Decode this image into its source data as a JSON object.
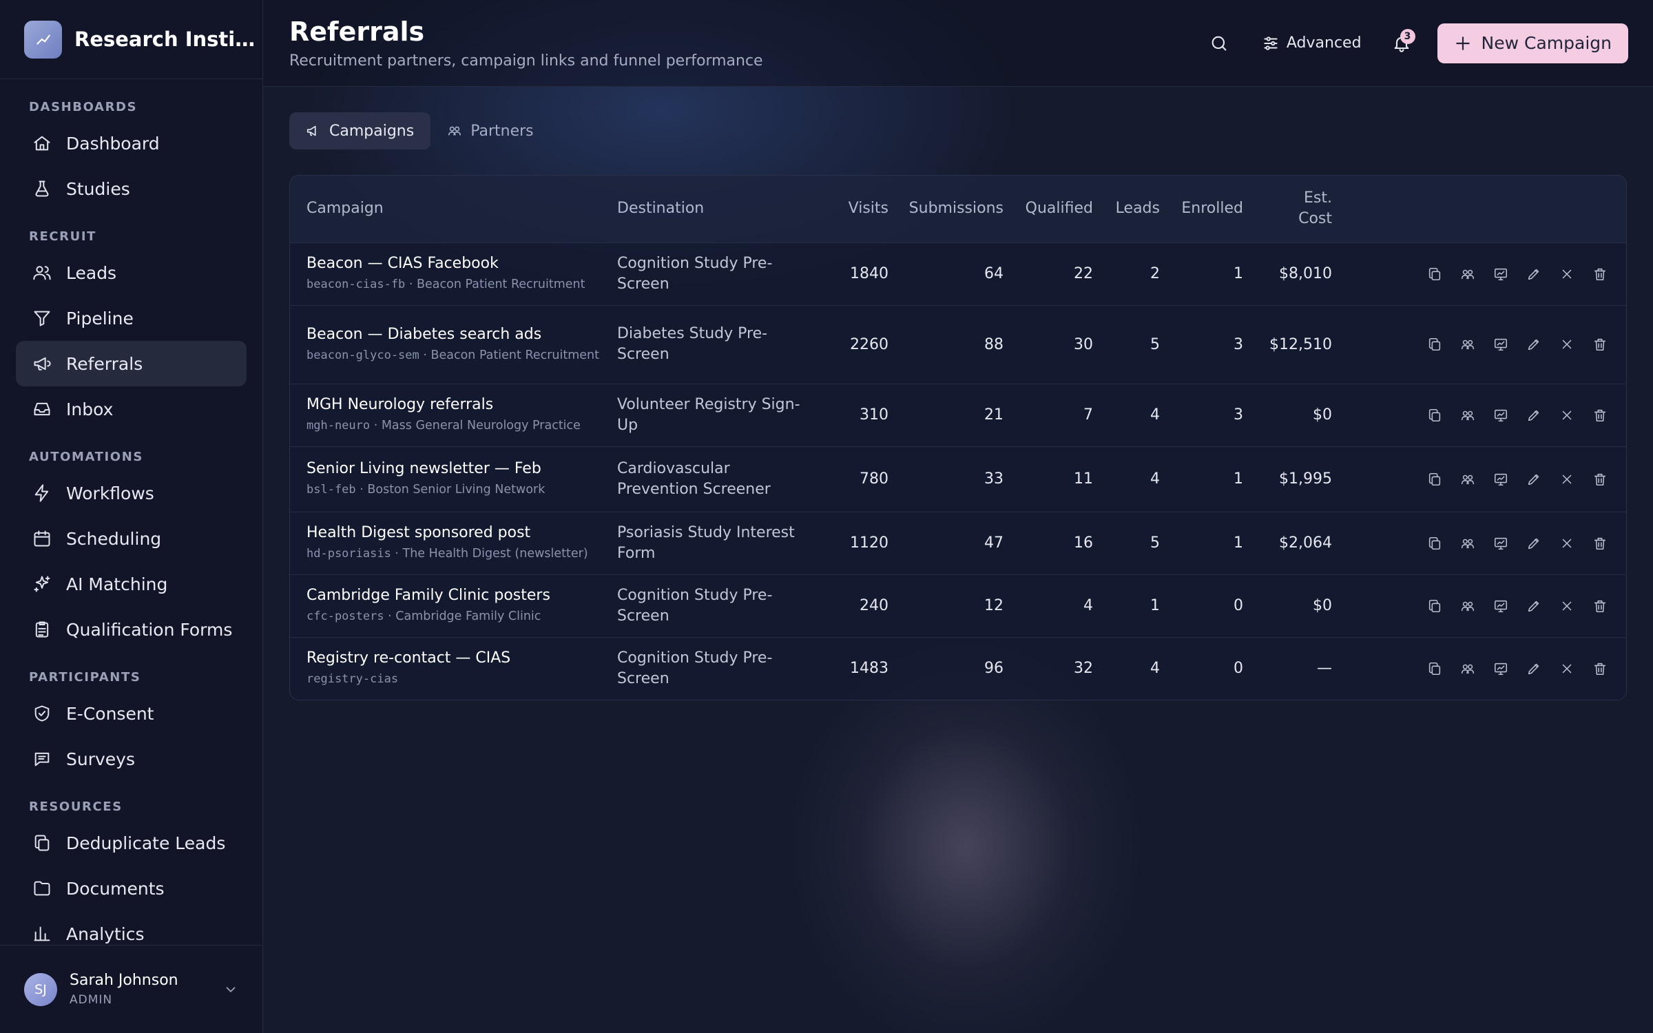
{
  "brand": {
    "name": "Research Institute"
  },
  "sidebar": {
    "sections": [
      {
        "title": "DASHBOARDS",
        "items": [
          {
            "label": "Dashboard",
            "icon": "home-icon"
          },
          {
            "label": "Studies",
            "icon": "flask-icon"
          }
        ]
      },
      {
        "title": "RECRUIT",
        "items": [
          {
            "label": "Leads",
            "icon": "users-icon"
          },
          {
            "label": "Pipeline",
            "icon": "funnel-icon"
          },
          {
            "label": "Referrals",
            "icon": "megaphone-icon",
            "active": true
          },
          {
            "label": "Inbox",
            "icon": "inbox-icon"
          }
        ]
      },
      {
        "title": "AUTOMATIONS",
        "items": [
          {
            "label": "Workflows",
            "icon": "bolt-icon"
          },
          {
            "label": "Scheduling",
            "icon": "calendar-icon"
          },
          {
            "label": "AI Matching",
            "icon": "sparkles-icon"
          },
          {
            "label": "Qualification Forms",
            "icon": "clipboard-icon"
          }
        ]
      },
      {
        "title": "PARTICIPANTS",
        "items": [
          {
            "label": "E-Consent",
            "icon": "shield-check-icon"
          },
          {
            "label": "Surveys",
            "icon": "chat-icon"
          }
        ]
      },
      {
        "title": "RESOURCES",
        "items": [
          {
            "label": "Deduplicate Leads",
            "icon": "copy-icon"
          },
          {
            "label": "Documents",
            "icon": "folder-icon"
          },
          {
            "label": "Analytics",
            "icon": "chart-icon"
          }
        ]
      }
    ]
  },
  "user": {
    "initials": "SJ",
    "name": "Sarah Johnson",
    "role": "ADMIN"
  },
  "header": {
    "title": "Referrals",
    "subtitle": "Recruitment partners, campaign links and funnel performance",
    "advanced_label": "Advanced",
    "notification_count": "3",
    "new_button_label": "New Campaign"
  },
  "tabs": [
    {
      "label": "Campaigns",
      "active": true
    },
    {
      "label": "Partners",
      "active": false
    }
  ],
  "table": {
    "columns": {
      "campaign": "Campaign",
      "destination": "Destination",
      "visits": "Visits",
      "submissions": "Submissions",
      "qualified": "Qualified",
      "leads": "Leads",
      "enrolled": "Enrolled",
      "est": "Est.",
      "cost": "Cost"
    },
    "rows": [
      {
        "name": "Beacon — CIAS Facebook",
        "slug": "beacon-cias-fb",
        "partner": "Beacon Patient Recruitment",
        "destination": "Cognition Study Pre-Screen",
        "visits": "1840",
        "submissions": "64",
        "qualified": "22",
        "leads": "2",
        "enrolled": "1",
        "cost": "$8,010"
      },
      {
        "name": "Beacon — Diabetes search ads",
        "slug": "beacon-glyco-sem",
        "partner": "Beacon Patient Recruitment",
        "destination": "Diabetes Study Pre-Screen",
        "visits": "2260",
        "submissions": "88",
        "qualified": "30",
        "leads": "5",
        "enrolled": "3",
        "cost": "$12,510"
      },
      {
        "name": "MGH Neurology referrals",
        "slug": "mgh-neuro",
        "partner": "Mass General Neurology Practice",
        "destination": "Volunteer Registry Sign-Up",
        "visits": "310",
        "submissions": "21",
        "qualified": "7",
        "leads": "4",
        "enrolled": "3",
        "cost": "$0"
      },
      {
        "name": "Senior Living newsletter — Feb",
        "slug": "bsl-feb",
        "partner": "Boston Senior Living Network",
        "destination": "Cardiovascular Prevention Screener",
        "visits": "780",
        "submissions": "33",
        "qualified": "11",
        "leads": "4",
        "enrolled": "1",
        "cost": "$1,995"
      },
      {
        "name": "Health Digest sponsored post",
        "slug": "hd-psoriasis",
        "partner": "The Health Digest (newsletter)",
        "destination": "Psoriasis Study Interest Form",
        "visits": "1120",
        "submissions": "47",
        "qualified": "16",
        "leads": "5",
        "enrolled": "1",
        "cost": "$2,064"
      },
      {
        "name": "Cambridge Family Clinic posters",
        "slug": "cfc-posters",
        "partner": "Cambridge Family Clinic",
        "destination": "Cognition Study Pre-Screen",
        "visits": "240",
        "submissions": "12",
        "qualified": "4",
        "leads": "1",
        "enrolled": "0",
        "cost": "$0"
      },
      {
        "name": "Registry re-contact — CIAS",
        "slug": "registry-cias",
        "partner": "",
        "destination": "Cognition Study Pre-Screen",
        "visits": "1483",
        "submissions": "96",
        "qualified": "32",
        "leads": "4",
        "enrolled": "0",
        "cost": "—"
      }
    ],
    "row_actions": [
      "copy-icon",
      "partners-icon",
      "analytics-icon",
      "edit-icon",
      "close-icon",
      "trash-icon"
    ]
  },
  "colors": {
    "accent": "#f4cde2",
    "background": "#151a2d",
    "sidebar": "#111527"
  }
}
